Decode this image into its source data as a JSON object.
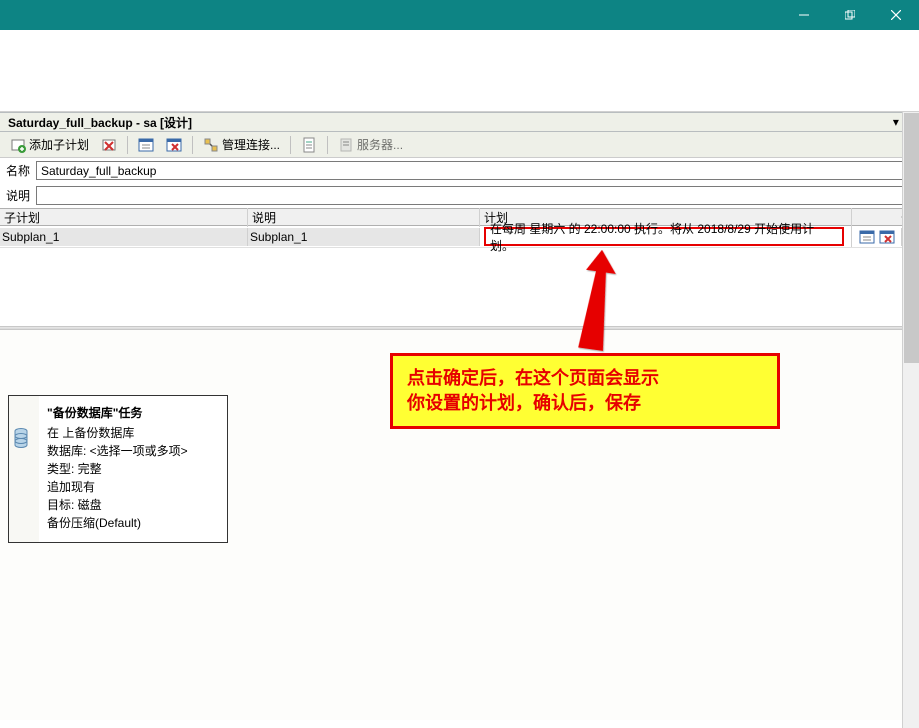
{
  "titlebar": {
    "min": "−",
    "max": "❐",
    "close": "✕"
  },
  "doc_tab": {
    "title": "Saturday_full_backup - sa [设计]"
  },
  "toolbar": {
    "add_subplan": "添加子计划",
    "manage_conn": "管理连接...",
    "servers": "服务器..."
  },
  "form": {
    "name_label": "名称",
    "name_value": "Saturday_full_backup",
    "desc_label": "说明",
    "desc_value": ""
  },
  "grid": {
    "head": {
      "subplan": "子计划",
      "desc": "说明",
      "plan": "计划"
    },
    "row": {
      "subplan": "Subplan_1",
      "desc": "Subplan_1",
      "plan": "在每周 星期六 的 22:00:00 执行。将从 2018/8/29 开始使用计划。"
    }
  },
  "task_card": {
    "title": "\"备份数据库\"任务",
    "lines": [
      "在 上备份数据库",
      "数据库: <选择一项或多项>",
      "类型: 完整",
      "追加现有",
      "目标: 磁盘",
      "备份压缩(Default)"
    ]
  },
  "callout": {
    "line1": "点击确定后，在这个页面会显示",
    "line2": "你设置的计划，确认后，保存"
  }
}
